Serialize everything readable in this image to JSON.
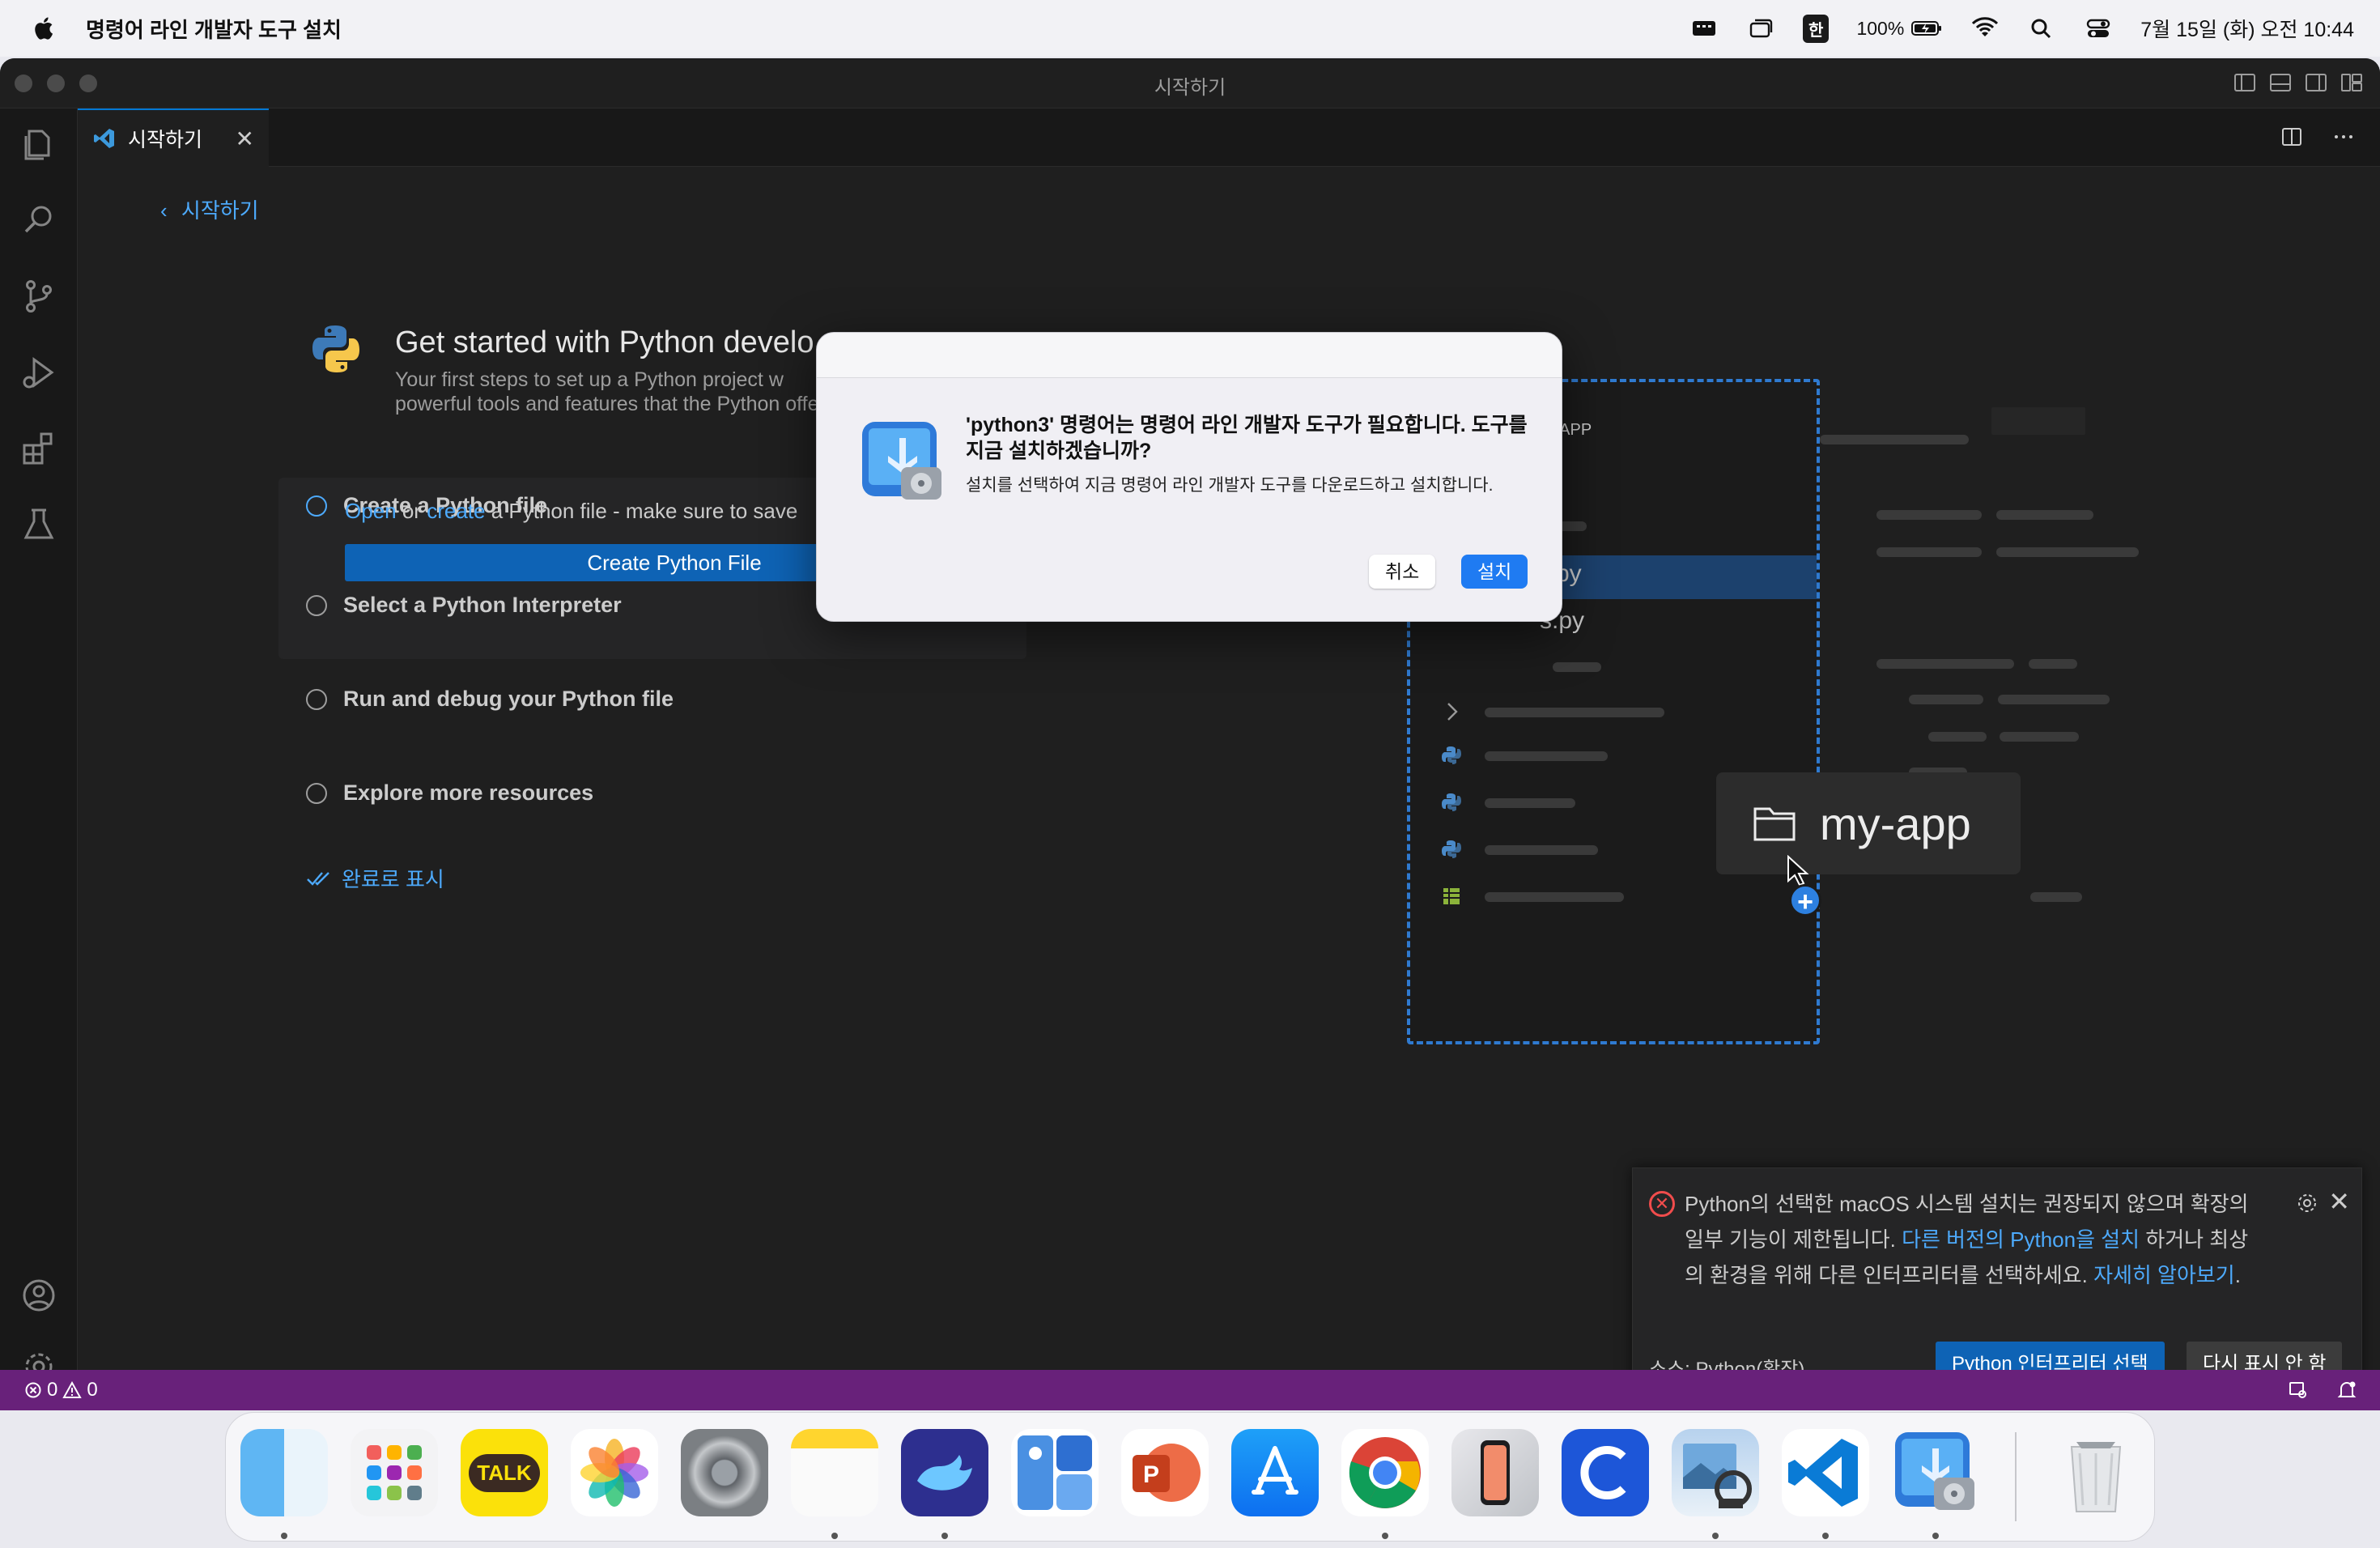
{
  "menubar": {
    "app_title": "명령어 라인 개발자 도구 설치",
    "ime": "한",
    "battery": "100%",
    "datetime": "7월 15일 (화) 오전 10:44"
  },
  "window": {
    "title": "시작하기"
  },
  "tab": {
    "label": "시작하기",
    "close": "✕"
  },
  "walkthrough": {
    "back_label": "시작하기",
    "title": "Get started with Python develo",
    "subtitle": "Your first steps to set up a Python project w powerful tools and features that the Python offer!",
    "steps": [
      {
        "label": "Create a Python file",
        "active": true
      },
      {
        "label": "Select a Python Interpreter",
        "active": false
      },
      {
        "label": "Run and debug your Python file",
        "active": false
      },
      {
        "label": "Explore more resources",
        "active": false
      }
    ],
    "step_desc_open": "Open",
    "step_desc_or": "or",
    "step_desc_create": "create",
    "step_desc_rest": "a Python file - make sure to save",
    "create_button": "Create Python File",
    "mark_done": "완료로 표시"
  },
  "illustration": {
    "header": "Y-APP",
    "file1": "py",
    "file2": "s.py",
    "tooltip_label": "my-app",
    "plus": "+"
  },
  "dialog": {
    "title": "'python3' 명령어는 명령어 라인 개발자 도구가 필요합니다. 도구를 지금 설치하겠습니까?",
    "body": "설치를 선택하여 지금 명령어 라인 개발자 도구를 다운로드하고 설치합니다.",
    "cancel": "취소",
    "install": "설치"
  },
  "notification": {
    "message_part1": "Python의 선택한 macOS 시스템 설치는 권장되지 않으며 확장의 일부 기능이 제한됩니다.",
    "message_link1": "다른 버전의 Python을 설치",
    "message_part2": "하거나 최상의 환경을 위해 다른 인터프리터를 선택하세요.",
    "message_link2": "자세히 알아보기",
    "message_end": ".",
    "source": "소스: Python(확장)",
    "primary_button": "Python 인터프리터 선택",
    "secondary_button": "다시 표시 안 함"
  },
  "statusbar": {
    "errors": "0",
    "warnings": "0"
  },
  "dock": {
    "apps": [
      "finder",
      "launchpad",
      "kakaotalk",
      "photos",
      "system-settings",
      "notes",
      "whale-browser",
      "folder-app",
      "powerpoint",
      "app-store",
      "chrome",
      "iphone-mirroring",
      "c-app",
      "preview",
      "vscode",
      "installer",
      "trash"
    ],
    "kakaotalk_label": "TALK"
  },
  "colors": {
    "accent": "#0078d4",
    "statusbar": "#68217a",
    "link": "#4daafc",
    "error": "#f14c4c",
    "dialog_install": "#1f7bf2"
  }
}
